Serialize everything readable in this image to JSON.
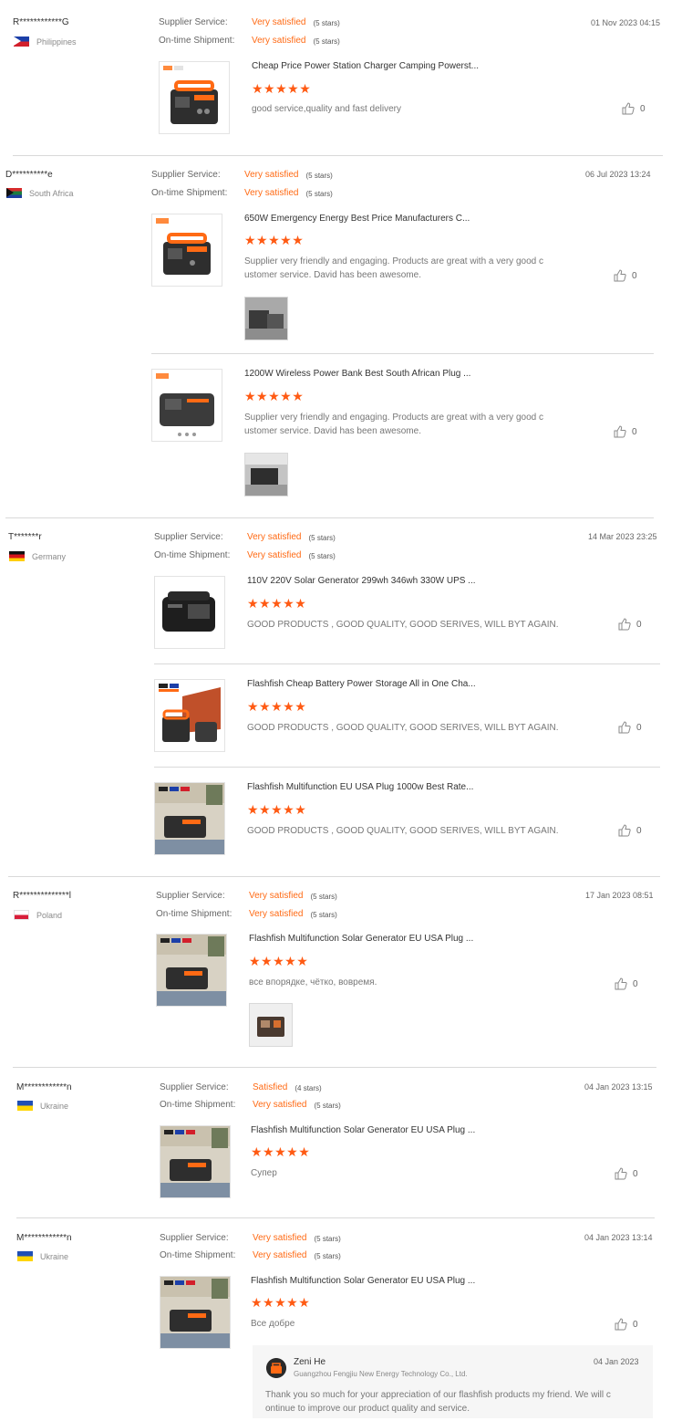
{
  "labels": {
    "supplier_service": "Supplier Service:",
    "ontime_shipment": "On-time Shipment:"
  },
  "reviews": [
    {
      "buyer": "R************G",
      "country": "Philippines",
      "flag": "ph",
      "date": "01 Nov 2023 04:15",
      "supplier_service": {
        "value": "Very satisfied",
        "stars": "(5 stars)"
      },
      "ontime_shipment": {
        "value": "Very satisfied",
        "stars": "(5 stars)"
      },
      "products": [
        {
          "title": "Cheap Price Power Station Charger Camping Powerst...",
          "rating": 5,
          "stars": "★★★★★",
          "text": "good service,quality and fast delivery",
          "likes": "0"
        }
      ]
    },
    {
      "buyer": "D**********e",
      "country": "South Africa",
      "flag": "za",
      "date": "06 Jul 2023 13:24",
      "supplier_service": {
        "value": "Very satisfied",
        "stars": "(5 stars)"
      },
      "ontime_shipment": {
        "value": "Very satisfied",
        "stars": "(5 stars)"
      },
      "products": [
        {
          "title": "650W Emergency Energy Best Price Manufacturers C...",
          "rating": 5,
          "stars": "★★★★★",
          "text": "Supplier very friendly and engaging. Products are great with a very good c ustomer service. David has been awesome.",
          "likes": "0"
        },
        {
          "title": "1200W Wireless Power Bank Best South African Plug ...",
          "rating": 5,
          "stars": "★★★★★",
          "text": "Supplier very friendly and engaging. Products are great with a very good c ustomer service. David has been awesome.",
          "likes": "0"
        }
      ]
    },
    {
      "buyer": "T*******r",
      "country": "Germany",
      "flag": "de",
      "date": "14 Mar 2023 23:25",
      "supplier_service": {
        "value": "Very satisfied",
        "stars": "(5 stars)"
      },
      "ontime_shipment": {
        "value": "Very satisfied",
        "stars": "(5 stars)"
      },
      "products": [
        {
          "title": "110V 220V Solar Generator 299wh 346wh 330W UPS ...",
          "rating": 5,
          "stars": "★★★★★",
          "text": "GOOD PRODUCTS , GOOD QUALITY, GOOD SERIVES,   WILL BYT AGAIN.",
          "likes": "0"
        },
        {
          "title": "Flashfish Cheap Battery Power Storage All in One Cha...",
          "rating": 5,
          "stars": "★★★★★",
          "text": "GOOD PRODUCTS , GOOD QUALITY, GOOD SERIVES,   WILL BYT AGAIN.",
          "likes": "0"
        },
        {
          "title": "Flashfish Multifunction EU USA Plug 1000w Best Rate...",
          "rating": 5,
          "stars": "★★★★★",
          "text": "GOOD PRODUCTS , GOOD QUALITY, GOOD SERIVES,   WILL BYT AGAIN.",
          "likes": "0"
        }
      ]
    },
    {
      "buyer": "R**************l",
      "country": "Poland",
      "flag": "pl",
      "date": "17 Jan 2023 08:51",
      "supplier_service": {
        "value": "Very satisfied",
        "stars": "(5 stars)"
      },
      "ontime_shipment": {
        "value": "Very satisfied",
        "stars": "(5 stars)"
      },
      "products": [
        {
          "title": "Flashfish Multifunction Solar Generator EU USA Plug ...",
          "rating": 5,
          "stars": "★★★★★",
          "text": "все впорядке, чётко, вовремя.",
          "likes": "0"
        }
      ]
    },
    {
      "buyer": "M************n",
      "country": "Ukraine",
      "flag": "ua",
      "date": "04 Jan 2023 13:15",
      "supplier_service": {
        "value": "Satisfied",
        "stars": "(4 stars)"
      },
      "ontime_shipment": {
        "value": "Very satisfied",
        "stars": "(5 stars)"
      },
      "products": [
        {
          "title": "Flashfish Multifunction Solar Generator EU USA Plug ...",
          "rating": 5,
          "stars": "★★★★★",
          "text": "Супер",
          "likes": "0"
        }
      ]
    },
    {
      "buyer": "M************n",
      "country": "Ukraine",
      "flag": "ua",
      "date": "04 Jan 2023 13:14",
      "supplier_service": {
        "value": "Very satisfied",
        "stars": "(5 stars)"
      },
      "ontime_shipment": {
        "value": "Very satisfied",
        "stars": "(5 stars)"
      },
      "products": [
        {
          "title": "Flashfish Multifunction Solar Generator EU USA Plug ...",
          "rating": 5,
          "stars": "★★★★★",
          "text": "Все добре",
          "likes": "0"
        }
      ],
      "reply": {
        "name": "Zeni He",
        "company": "Guangzhou Fengjiu New Energy Technology Co., Ltd.",
        "date": "04 Jan 2023",
        "text": "Thank you so much for your appreciation of our flashfish products my friend. We will c ontinue to improve our product quality and service."
      }
    }
  ],
  "colors": {
    "accent": "#ff6a14",
    "star": "#ff5a13"
  }
}
